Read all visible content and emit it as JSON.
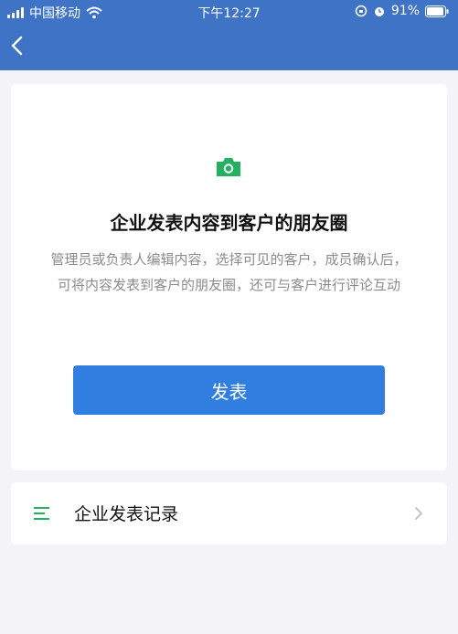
{
  "status_bar": {
    "carrier": "中国移动",
    "time": "下午12:27",
    "battery": "91%"
  },
  "nav": {
    "back_icon": "chevron-left-icon"
  },
  "intro": {
    "icon": "camera-icon",
    "title": "企业发表内容到客户的朋友圈",
    "description": "管理员或负责人编辑内容，选择可见的客户，成员确认后，可将内容发表到客户的朋友圈，还可与客户进行评论互动",
    "publish_button": "发表"
  },
  "records_row": {
    "icon": "list-icon",
    "label": "企业发表记录",
    "chevron": "chevron-right-icon"
  },
  "colors": {
    "nav_bg": "#3f73c6",
    "button_bg": "#2f7ee0",
    "icon_green": "#23b05f",
    "page_bg": "#f3f3f8"
  }
}
